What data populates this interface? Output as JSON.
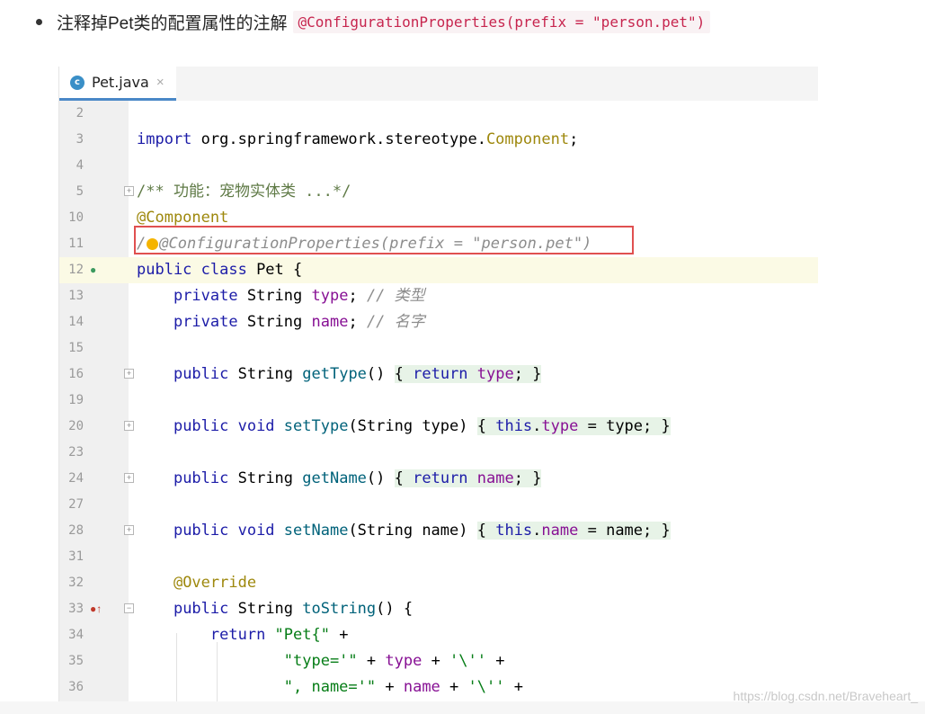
{
  "instruction": {
    "text": "注释掉Pet类的配置属性的注解",
    "code": "@ConfigurationProperties(prefix = \"person.pet\")"
  },
  "editor": {
    "tab": {
      "icon_letter": "c",
      "file_name": "Pet.java",
      "close_symbol": "×"
    },
    "line_numbers": [
      "2",
      "3",
      "4",
      "5",
      "10",
      "11",
      "12",
      "13",
      "14",
      "15",
      "16",
      "19",
      "20",
      "23",
      "24",
      "27",
      "28",
      "31",
      "32",
      "33",
      "34",
      "35",
      "36"
    ],
    "code": {
      "import_kw": "import",
      "import_path": " org.springframework.stereotype.",
      "import_cls": "Component",
      "import_end": ";",
      "doc_comment": "/** 功能：宠物实体类 ...*/",
      "component_ann": "@Component",
      "commented_ann_prefix": "/",
      "commented_ann": "@ConfigurationProperties(prefix = \"person.pet\")",
      "class_kw": "public class",
      "class_rest": " Pet {",
      "field_type": {
        "mod": "private",
        "type": " String ",
        "name": "type",
        "end": "; ",
        "comment": "// 类型"
      },
      "field_name": {
        "mod": "private",
        "type": " String ",
        "name": "name",
        "end": "; ",
        "comment": "// 名字"
      },
      "getType": {
        "mod": "public",
        "rest": " String ",
        "method": "getType",
        "parens": "() ",
        "open": "{ ",
        "ret": "return",
        "val": " type",
        "semi": "; ",
        "close": "}"
      },
      "setType": {
        "mod": "public void",
        "method": " setType",
        "params": "(String type) ",
        "open": "{ ",
        "this": "this",
        "dot": ".",
        "field": "type",
        "assign": " = type; ",
        "close": "}"
      },
      "getName": {
        "mod": "public",
        "rest": " String ",
        "method": "getName",
        "parens": "() ",
        "open": "{ ",
        "ret": "return",
        "val": " name",
        "semi": "; ",
        "close": "}"
      },
      "setName": {
        "mod": "public void",
        "method": " setName",
        "params": "(String name) ",
        "open": "{ ",
        "this": "this",
        "dot": ".",
        "field": "name",
        "assign": " = name; ",
        "close": "}"
      },
      "override_ann": "@Override",
      "toString": {
        "mod": "public",
        "rest": " String ",
        "method": "toString",
        "tail": "() {"
      },
      "return_line": {
        "ret": "return",
        "str": " \"Pet{\"",
        "tail": " +"
      },
      "type_concat": {
        "s1": "\"type='\"",
        "p1": " + ",
        "v": "type",
        "p2": " + ",
        "s2": "'\\''",
        "p3": " +"
      },
      "name_concat": {
        "s1": "\", name='\"",
        "p1": " + ",
        "v": "name",
        "p2": " + ",
        "s2": "'\\''",
        "p3": " +"
      }
    },
    "gutter_icons": {
      "line12": "bean-icon",
      "line33": "override-arrow-icon"
    }
  },
  "watermark": "https://blog.csdn.net/Braveheart_"
}
